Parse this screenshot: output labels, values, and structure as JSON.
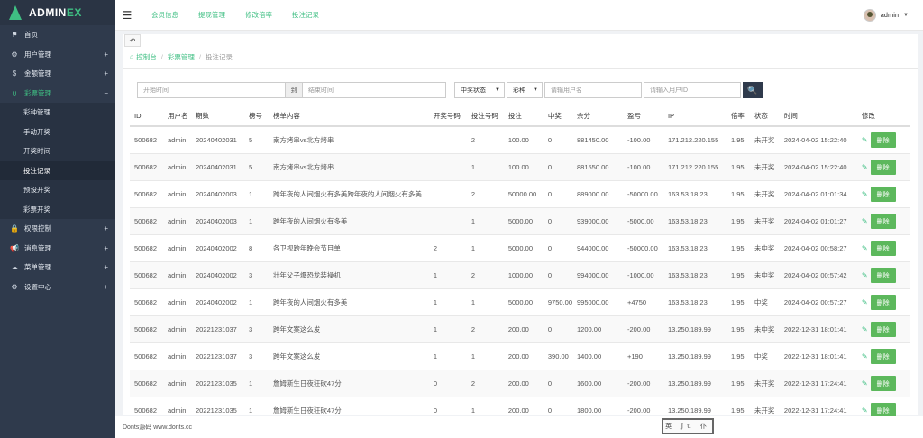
{
  "brand": {
    "prefix": "ADMIN",
    "suffix": "EX"
  },
  "sidebar": {
    "items": [
      {
        "label": "首页",
        "icon": "flag-icon",
        "glyph": "⚑",
        "expand": ""
      },
      {
        "label": "用户管理",
        "icon": "gear-icon",
        "glyph": "⚙",
        "expand": "+"
      },
      {
        "label": "金额管理",
        "icon": "dollar-icon",
        "glyph": "$",
        "expand": "+"
      },
      {
        "label": "彩票管理",
        "icon": "magnet-icon",
        "glyph": "∪",
        "expand": "−"
      }
    ],
    "submenu": [
      "彩种管理",
      "手动开奖",
      "开奖时间",
      "投注记录",
      "预设开奖",
      "彩票开奖"
    ],
    "active_sub": 3,
    "items_after": [
      {
        "label": "权限控制",
        "icon": "lock-icon",
        "glyph": "🔒",
        "expand": "+"
      },
      {
        "label": "消息管理",
        "icon": "bullhorn-icon",
        "glyph": "📢",
        "expand": "+"
      },
      {
        "label": "菜单管理",
        "icon": "cloud-icon",
        "glyph": "☁",
        "expand": "+"
      },
      {
        "label": "设置中心",
        "icon": "cog-icon",
        "glyph": "⚙",
        "expand": "+"
      }
    ]
  },
  "topbar": {
    "nav": [
      "会员信息",
      "提现管理",
      "修改倍率",
      "投注记录"
    ],
    "user": "admin"
  },
  "breadcrumb": [
    "控制台",
    "彩票管理",
    "投注记录"
  ],
  "search": {
    "start_placeholder": "开始时间",
    "to_label": "到",
    "end_placeholder": "结束时间",
    "status_select": "中奖状态",
    "type_select": "彩种",
    "username_placeholder": "请输用户名",
    "userid_placeholder": "请输入用户ID"
  },
  "table": {
    "headers": [
      "ID",
      "用户名",
      "期数",
      "榜号",
      "榜单内容",
      "开奖号码",
      "投注号码",
      "投注",
      "中奖",
      "余分",
      "盈亏",
      "IP",
      "倍率",
      "状态",
      "时间",
      "修改"
    ],
    "rows": [
      [
        "500682",
        "admin",
        "20240402031",
        "5",
        "南方烤串vs北方烤串",
        "",
        "2",
        "100.00",
        "0",
        "881450.00",
        "-100.00",
        "171.212.220.155",
        "1.95",
        "未开奖",
        "2024-04-02 15:22:40"
      ],
      [
        "500682",
        "admin",
        "20240402031",
        "5",
        "南方烤串vs北方烤串",
        "",
        "1",
        "100.00",
        "0",
        "881550.00",
        "-100.00",
        "171.212.220.155",
        "1.95",
        "未开奖",
        "2024-04-02 15:22:40"
      ],
      [
        "500682",
        "admin",
        "20240402003",
        "1",
        "跨年夜的人间烟火有多美跨年夜的人间烟火有多美",
        "",
        "2",
        "50000.00",
        "0",
        "889000.00",
        "-50000.00",
        "163.53.18.23",
        "1.95",
        "未开奖",
        "2024-04-02 01:01:34"
      ],
      [
        "500682",
        "admin",
        "20240402003",
        "1",
        "跨年夜的人间烟火有多美",
        "",
        "1",
        "5000.00",
        "0",
        "939000.00",
        "-5000.00",
        "163.53.18.23",
        "1.95",
        "未开奖",
        "2024-04-02 01:01:27"
      ],
      [
        "500682",
        "admin",
        "20240402002",
        "8",
        "各卫视跨年晚会节目单",
        "2",
        "1",
        "5000.00",
        "0",
        "944000.00",
        "-50000.00",
        "163.53.18.23",
        "1.95",
        "未中奖",
        "2024-04-02 00:58:27"
      ],
      [
        "500682",
        "admin",
        "20240402002",
        "3",
        "壮年父子爆恐龙装操机",
        "1",
        "2",
        "1000.00",
        "0",
        "994000.00",
        "-1000.00",
        "163.53.18.23",
        "1.95",
        "未中奖",
        "2024-04-02 00:57:42"
      ],
      [
        "500682",
        "admin",
        "20240402002",
        "1",
        "跨年夜的人间烟火有多美",
        "1",
        "1",
        "5000.00",
        "9750.00",
        "995000.00",
        "+4750",
        "163.53.18.23",
        "1.95",
        "中奖",
        "2024-04-02 00:57:27"
      ],
      [
        "500682",
        "admin",
        "20221231037",
        "3",
        "跨年文案这么发",
        "1",
        "2",
        "200.00",
        "0",
        "1200.00",
        "-200.00",
        "13.250.189.99",
        "1.95",
        "未中奖",
        "2022-12-31 18:01:41"
      ],
      [
        "500682",
        "admin",
        "20221231037",
        "3",
        "跨年文案这么发",
        "1",
        "1",
        "200.00",
        "390.00",
        "1400.00",
        "+190",
        "13.250.189.99",
        "1.95",
        "中奖",
        "2022-12-31 18:01:41"
      ],
      [
        "500682",
        "admin",
        "20221231035",
        "1",
        "詹姆斯生日夜狂砍47分",
        "0",
        "2",
        "200.00",
        "0",
        "1600.00",
        "-200.00",
        "13.250.189.99",
        "1.95",
        "未开奖",
        "2022-12-31 17:24:41"
      ],
      [
        "500682",
        "admin",
        "20221231035",
        "1",
        "詹姆斯生日夜狂砍47分",
        "0",
        "1",
        "200.00",
        "0",
        "1800.00",
        "-200.00",
        "13.250.189.99",
        "1.95",
        "未开奖",
        "2022-12-31 17:24:41"
      ]
    ],
    "delete_label": "删除"
  },
  "footer": {
    "text": "Donts源码 www.donts.cc",
    "seal": "英 Ju 仆"
  },
  "colors": {
    "accent": "#3fbf83",
    "sidebar_bg": "#2f3a4c",
    "negative": "#e02020",
    "positive": "#1a3fdc",
    "delete_btn": "#5cb85c"
  }
}
